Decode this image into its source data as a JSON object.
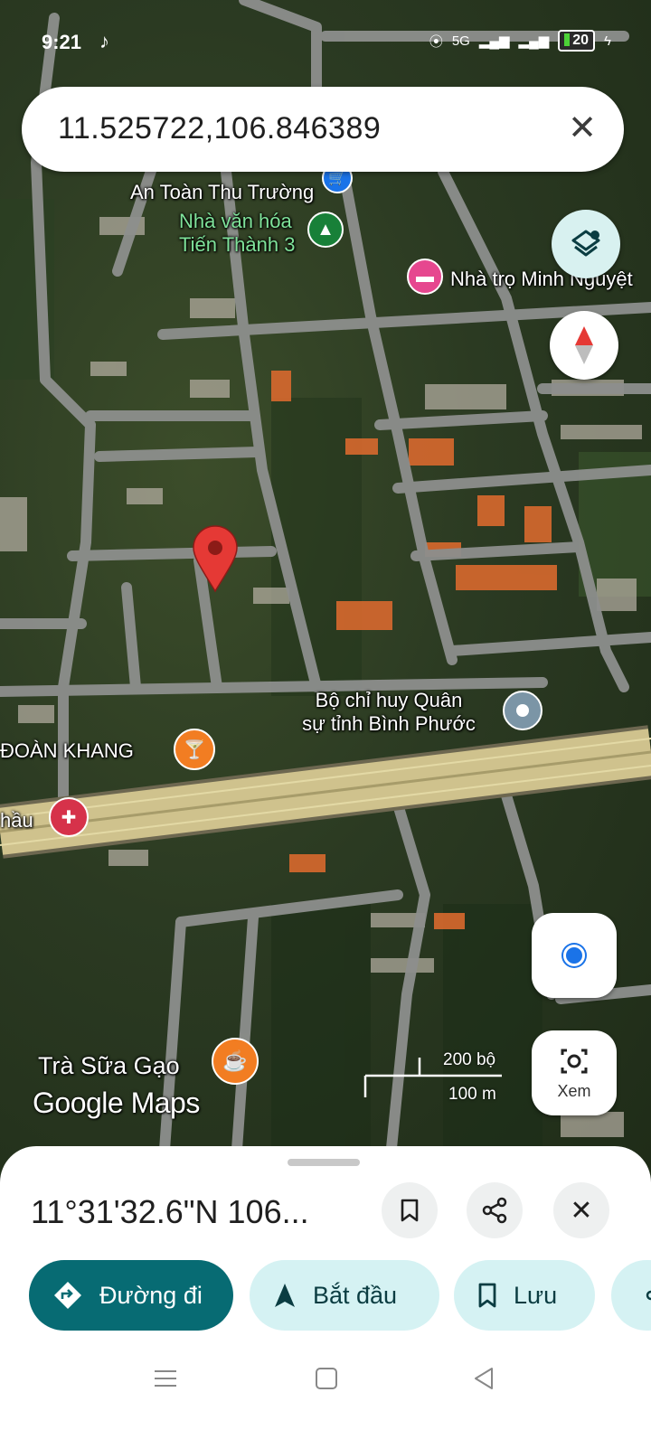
{
  "status_bar": {
    "time": "9:21",
    "network": "5G",
    "battery": "20"
  },
  "search": {
    "query": "11.525722,106.846389"
  },
  "map": {
    "pois": [
      {
        "label": "An Toàn Thu Trường",
        "type": "shop"
      },
      {
        "label": "Nhà văn hóa\nTiến Thành 3",
        "type": "park"
      },
      {
        "label": "Nhà trọ Minh Nguyệt",
        "type": "lodging"
      },
      {
        "label": "Bộ chỉ huy Quân\nsự tỉnh Bình Phước",
        "type": "government"
      },
      {
        "label": "ĐOÀN KHANG",
        "type": "bar"
      },
      {
        "label": "hầu",
        "type": "pharmacy"
      },
      {
        "label": "Trà Sữa Gạo",
        "type": "cafe"
      }
    ],
    "scale": {
      "imperial": "200 bộ",
      "metric": "100 m"
    },
    "logo": "Google Maps",
    "view_button_label": "Xem"
  },
  "sheet": {
    "coordinates": "11°31'32.6\"N 106...",
    "chips": {
      "directions": "Đường đi",
      "start": "Bắt đầu",
      "save": "Lưu"
    }
  },
  "colors": {
    "accent": "#076b73",
    "chip_bg": "#d5f2f3",
    "pin": "#e53935",
    "location_dot": "#1a73e8"
  }
}
